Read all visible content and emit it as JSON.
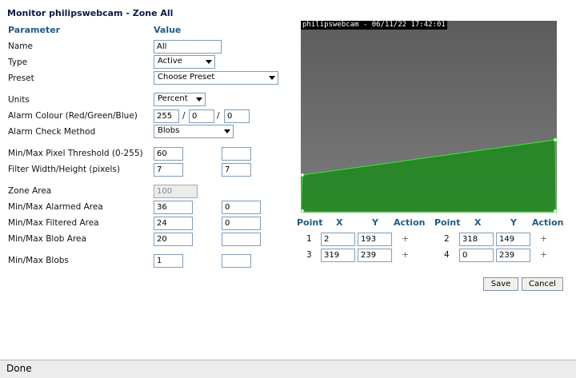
{
  "page_title": "Monitor philipswebcam - Zone All",
  "headers": {
    "parameter": "Parameter",
    "value": "Value"
  },
  "fields": {
    "name": {
      "label": "Name",
      "value": "All"
    },
    "type": {
      "label": "Type",
      "value": "Active"
    },
    "preset": {
      "label": "Preset",
      "value": "Choose Preset"
    },
    "units": {
      "label": "Units",
      "value": "Percent"
    },
    "alarm_colour": {
      "label": "Alarm Colour (Red/Green/Blue)",
      "red": "255",
      "green": "0",
      "blue": "0",
      "sep": "/"
    },
    "check_method": {
      "label": "Alarm Check Method",
      "value": "Blobs"
    },
    "pixel_threshold": {
      "label": "Min/Max Pixel Threshold (0-255)",
      "min": "60",
      "max": ""
    },
    "filter_size": {
      "label": "Filter Width/Height (pixels)",
      "width": "7",
      "height": "7"
    },
    "zone_area": {
      "label": "Zone Area",
      "value": "100"
    },
    "alarmed_area": {
      "label": "Min/Max Alarmed Area",
      "min": "36",
      "max": "0"
    },
    "filtered_area": {
      "label": "Min/Max Filtered Area",
      "min": "24",
      "max": "0"
    },
    "blob_area": {
      "label": "Min/Max Blob Area",
      "min": "20",
      "max": ""
    },
    "blobs": {
      "label": "Min/Max Blobs",
      "min": "1",
      "max": ""
    }
  },
  "camera": {
    "overlay_text": "philipswebcam - 06/11/22 17:42:01",
    "zone_fill_color": "#1c8a1c",
    "zone_stroke_color": "#33ee33"
  },
  "points_table": {
    "headers": {
      "point": "Point",
      "x": "X",
      "y": "Y",
      "action": "Action"
    },
    "add_symbol": "+",
    "points": [
      {
        "n": "1",
        "x": "2",
        "y": "193"
      },
      {
        "n": "2",
        "x": "318",
        "y": "149"
      },
      {
        "n": "3",
        "x": "319",
        "y": "239"
      },
      {
        "n": "4",
        "x": "0",
        "y": "239"
      }
    ]
  },
  "buttons": {
    "save": "Save",
    "cancel": "Cancel"
  },
  "status_bar": {
    "text": "Done"
  }
}
